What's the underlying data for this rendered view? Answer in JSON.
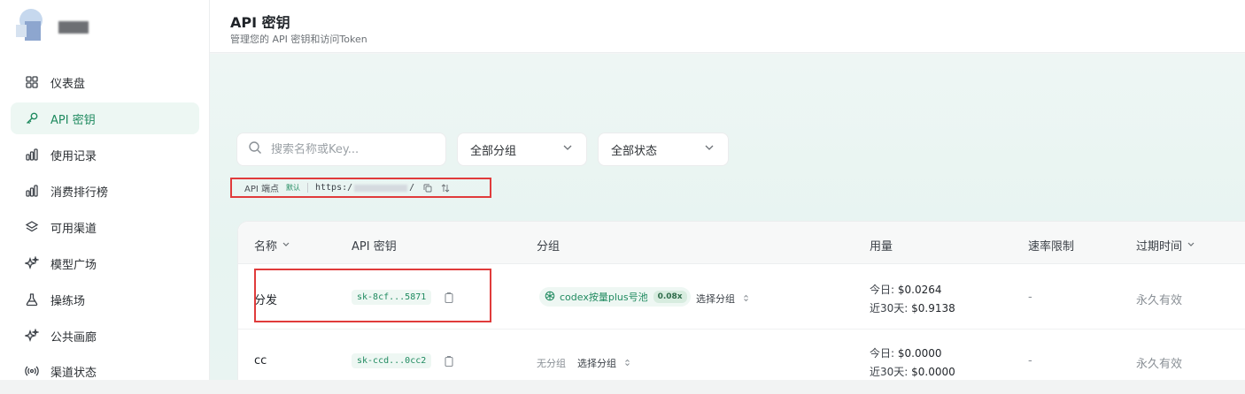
{
  "sidebar": {
    "items": [
      {
        "label": "仪表盘",
        "icon": "grid-icon"
      },
      {
        "label": "API 密钥",
        "icon": "key-icon",
        "active": true
      },
      {
        "label": "使用记录",
        "icon": "bar-chart-icon"
      },
      {
        "label": "消费排行榜",
        "icon": "bar-chart-icon"
      },
      {
        "label": "可用渠道",
        "icon": "layers-icon"
      },
      {
        "label": "模型广场",
        "icon": "sparkle-icon"
      },
      {
        "label": "操练场",
        "icon": "flask-icon"
      },
      {
        "label": "公共画廊",
        "icon": "sparkle-icon"
      },
      {
        "label": "渠道状态",
        "icon": "signal-icon"
      }
    ]
  },
  "header": {
    "title": "API 密钥",
    "subtitle": "管理您的 API 密钥和访问Token"
  },
  "filters": {
    "search_placeholder": "搜索名称或Key...",
    "group_select": "全部分组",
    "status_select": "全部状态"
  },
  "endpoint": {
    "label": "API 端点",
    "badge": "默认",
    "url_prefix": "https:/",
    "url_suffix": "/"
  },
  "table": {
    "columns": {
      "name": "名称",
      "key": "API 密钥",
      "group": "分组",
      "usage": "用量",
      "rate_limit": "速率限制",
      "expiry": "过期时间"
    },
    "rows": [
      {
        "name": "分发",
        "key": "sk-8cf...5871",
        "group": "codex按量plus号池",
        "ratio": "0.08x",
        "select_group": "选择分组",
        "today_label": "今日:",
        "today_value": "$0.0264",
        "month_label": "近30天:",
        "month_value": "$0.9138",
        "rate_limit": "-",
        "expiry": "永久有效"
      },
      {
        "name": "cc",
        "key": "sk-ccd...0cc2",
        "group_none": "无分组",
        "select_group": "选择分组",
        "today_label": "今日:",
        "today_value": "$0.0000",
        "month_label": "近30天:",
        "month_value": "$0.0000",
        "rate_limit": "-",
        "expiry": "永久有效"
      }
    ]
  },
  "colors": {
    "accent": "#1f8a5f",
    "highlight_box": "#e03b3b"
  }
}
